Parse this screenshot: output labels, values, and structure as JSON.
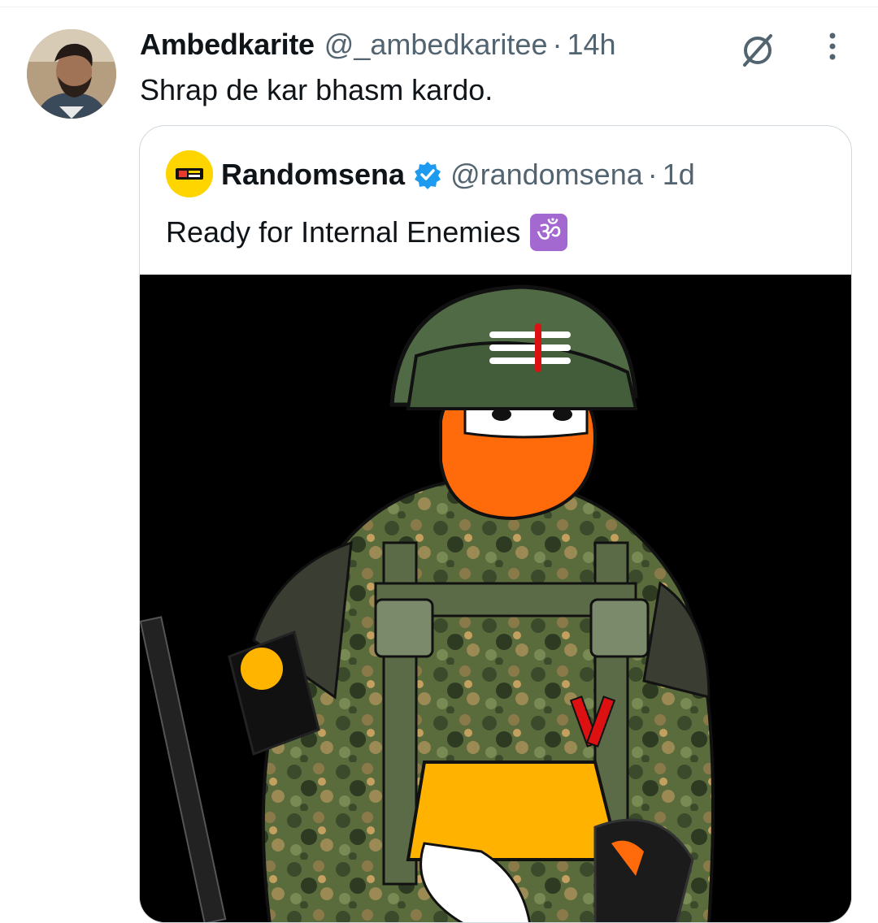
{
  "tweet": {
    "author_name": "Ambedkarite",
    "author_handle": "@_ambedkaritee",
    "separator": "·",
    "time": "14h",
    "text": "Shrap de kar bhasm kardo."
  },
  "quoted_tweet": {
    "author_name": "Randomsena",
    "author_handle": "@randomsena",
    "separator": "·",
    "time": "1d",
    "text": "Ready for Internal Enemies",
    "emoji": "ॐ",
    "verified": true
  },
  "icons": {
    "grok": "grok-icon",
    "more": "more-options-icon",
    "verified": "verified-badge-icon"
  },
  "colors": {
    "text_primary": "#0f1419",
    "text_secondary": "#536471",
    "verified_blue": "#1d9bf0",
    "quote_border": "#cfd9de",
    "om_emoji_bg": "#a469d1"
  }
}
